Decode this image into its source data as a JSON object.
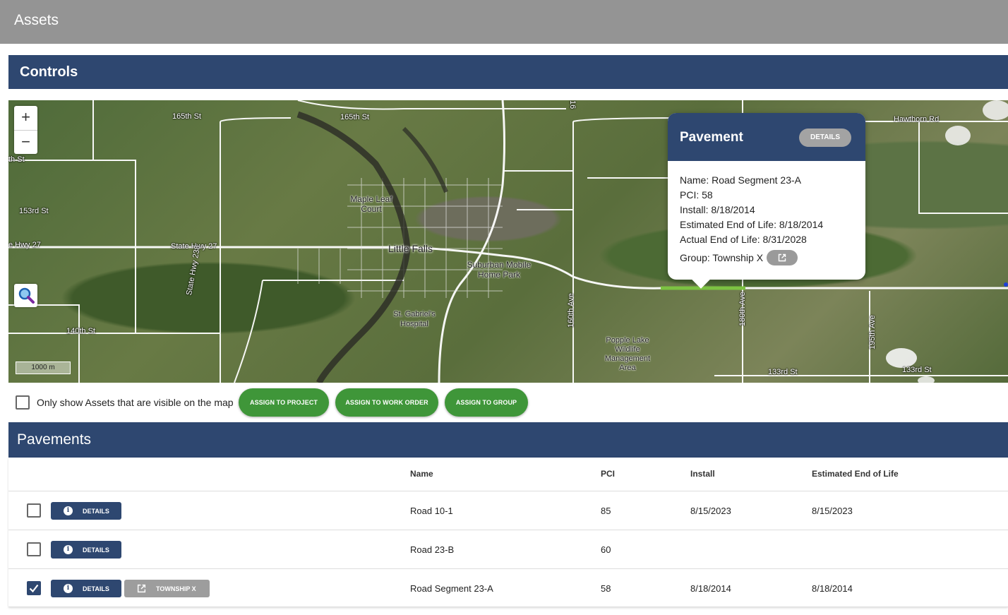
{
  "app": {
    "title": "Assets"
  },
  "controls": {
    "title": "Controls"
  },
  "map": {
    "zoom_in": "+",
    "zoom_out": "−",
    "scale_label": "1000 m",
    "labels": {
      "s165_a": "165th St",
      "s165_b": "165th St",
      "s153": "153rd St",
      "th_st": "th St",
      "hwy27_a": "e Hwy 27",
      "hwy27_b": "State Hwy 27",
      "hwy238": "State Hwy 238",
      "s140": "140th St",
      "s133_a": "133rd St",
      "s133_b": "133rd St",
      "hawthorn": "Hawthorn Rd",
      "ave160": "160th Ave",
      "ave180": "180th Ave",
      "ave195": "195th Ave",
      "ave16": "16",
      "little_falls": "Little Falls",
      "maple_leaf": "Maple Leaf Court",
      "suburban": "Suburban Mobile Home Park",
      "st_gabriel": "St. Gabriel's Hospital",
      "popple": "Popple Lake Wildlife Management Area"
    },
    "popup": {
      "title": "Pavement",
      "details_label": "DETAILS",
      "name_line": "Name: Road Segment 23-A",
      "pci_line": "PCI: 58",
      "install_line": "Install: 8/18/2014",
      "est_line": "Estimated End of Life: 8/18/2014",
      "actual_line": "Actual End of Life: 8/31/2028",
      "group_line": "Group: Township X"
    }
  },
  "filter": {
    "label": "Only show Assets that are visible on the map",
    "checked": false
  },
  "actions": {
    "assign_project": "ASSIGN TO PROJECT",
    "assign_work_order": "ASSIGN TO WORK ORDER",
    "assign_group": "ASSIGN TO GROUP"
  },
  "pavements": {
    "title": "Pavements",
    "columns": {
      "name": "Name",
      "pci": "PCI",
      "install": "Install",
      "eol": "Estimated End of Life"
    },
    "details_label": "DETAILS",
    "rows": [
      {
        "name": "Road 10-1",
        "pci": "85",
        "install": "8/15/2023",
        "eol": "8/15/2023",
        "checked": false,
        "group": ""
      },
      {
        "name": "Road 23-B",
        "pci": "60",
        "install": "",
        "eol": "",
        "checked": false,
        "group": ""
      },
      {
        "name": "Road Segment 23-A",
        "pci": "58",
        "install": "8/18/2014",
        "eol": "8/18/2014",
        "checked": true,
        "group": "TOWNSHIP X"
      }
    ]
  },
  "colors": {
    "header": "#2e4770",
    "appbar": "#949494",
    "action_green": "#3f9639",
    "selected_segment": "#7cc242"
  }
}
